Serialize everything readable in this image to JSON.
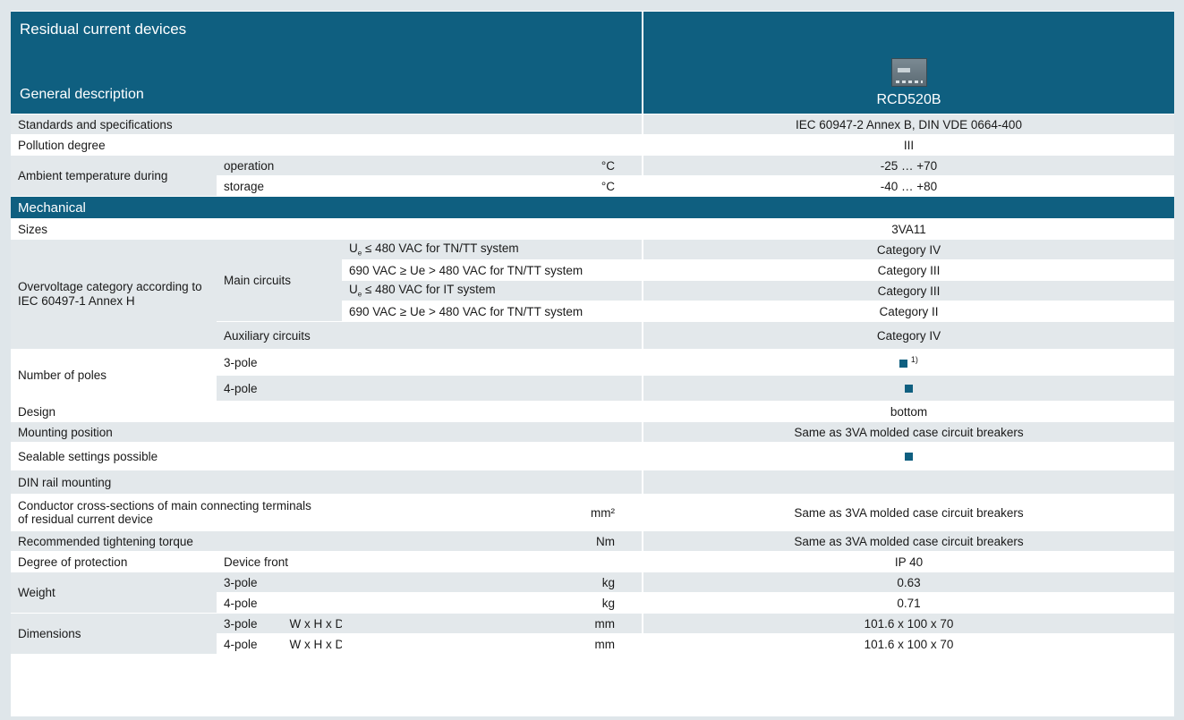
{
  "header": {
    "title": "Residual current devices",
    "subtitle": "General description",
    "product": "RCD520B",
    "product_image": "rcd-device-image"
  },
  "rows": {
    "standards": {
      "label": "Standards and specifications",
      "value": "IEC 60947-2 Annex B, DIN VDE 0664-400"
    },
    "pollution": {
      "label": "Pollution degree",
      "value": "III"
    },
    "ambient": {
      "label": "Ambient temperature during",
      "operation": {
        "label": "operation",
        "unit": "°C",
        "value": "-25 … +70"
      },
      "storage": {
        "label": "storage",
        "unit": "°C",
        "value": "-40 … +80"
      }
    },
    "mechanical": {
      "label": "Mechanical"
    },
    "sizes": {
      "label": "Sizes",
      "value": "3VA11"
    },
    "overvoltage": {
      "label": "Overvoltage category according to IEC 60497-1 Annex H",
      "main_label": "Main circuits",
      "r1": {
        "cond_pre": "U",
        "cond_sub": "e",
        "cond_post": " ≤ 480 VAC for TN/TT system",
        "value": "Category IV"
      },
      "r2": {
        "cond": "690 VAC ≥ Ue > 480 VAC for TN/TT system",
        "value": "Category III"
      },
      "r3": {
        "cond_pre": "U",
        "cond_sub": "e",
        "cond_post": " ≤ 480 VAC for IT system",
        "value": "Category III"
      },
      "r4": {
        "cond": "690 VAC ≥ Ue > 480 VAC for TN/TT system",
        "value": "Category II"
      },
      "aux": {
        "label": "Auxiliary circuits",
        "value": "Category IV"
      }
    },
    "poles": {
      "label": "Number of poles",
      "p3": {
        "label": "3-pole",
        "footnote": "1)"
      },
      "p4": {
        "label": "4-pole"
      }
    },
    "design": {
      "label": "Design",
      "value": "bottom"
    },
    "mounting": {
      "label": "Mounting position",
      "value": "Same as 3VA molded case circuit breakers"
    },
    "sealable": {
      "label": "Sealable settings possible"
    },
    "din": {
      "label": "DIN rail mounting"
    },
    "conductor": {
      "label1": "Conductor cross-sections of main connecting terminals",
      "label2": "of residual current device",
      "unit": "mm²",
      "value": "Same as 3VA molded case circuit breakers"
    },
    "torque": {
      "label": "Recommended tightening torque",
      "unit": "Nm",
      "value": "Same as 3VA molded case circuit breakers"
    },
    "protection": {
      "label": "Degree of protection",
      "sub": "Device front",
      "value": "IP 40"
    },
    "weight": {
      "label": "Weight",
      "p3": {
        "label": "3-pole",
        "unit": "kg",
        "value": "0.63"
      },
      "p4": {
        "label": "4-pole",
        "unit": "kg",
        "value": "0.71"
      }
    },
    "dimensions": {
      "label": "Dimensions",
      "p3": {
        "label": "3-pole",
        "dims": "W x H x D",
        "unit": "mm",
        "value": "101.6 x 100 x 70"
      },
      "p4": {
        "label": "4-pole",
        "dims": "W x H x D",
        "unit": "mm",
        "value": "101.6 x 100 x 70"
      }
    }
  }
}
